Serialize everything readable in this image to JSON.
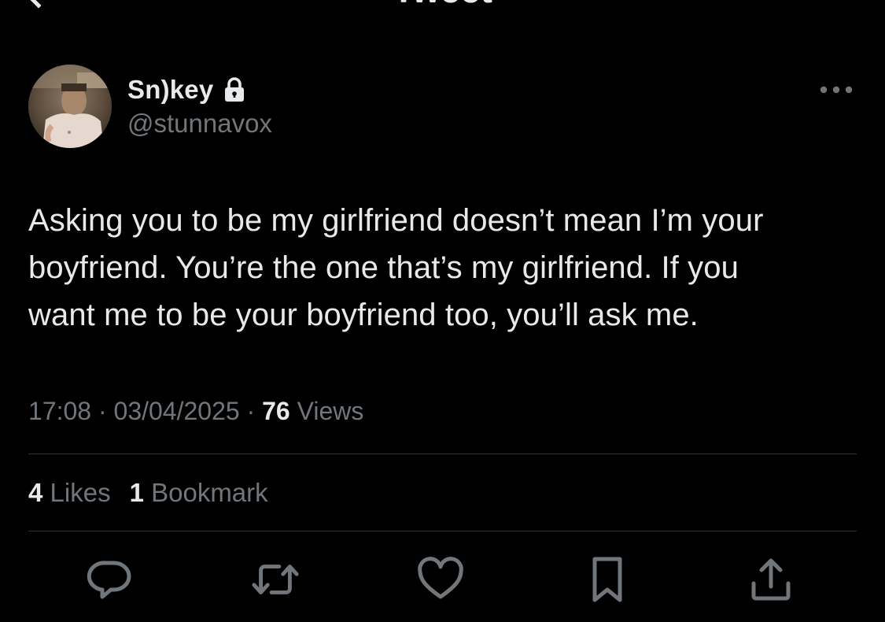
{
  "header": {
    "title": "Tweet"
  },
  "author": {
    "name": "Sn)key",
    "handle": "@stunnavox",
    "protected_icon": "lock-icon",
    "avatar_description_colors": [
      "#4a4036",
      "#d9c3b0"
    ]
  },
  "tweet": {
    "text": "Asking you to be my girlfriend doesn’t mean I’m your\nboyfriend. You’re the one that’s my girlfriend. If you\nwant me to be your boyfriend too, you’ll ask me.",
    "time": "17:08",
    "date": "03/04/2025",
    "separator": " · ",
    "views_count": "76",
    "views_label": " Views"
  },
  "stats": {
    "likes_count": "4",
    "likes_label": " Likes",
    "bookmarks_count": "1",
    "bookmarks_label": " Bookmark"
  },
  "actions": [
    {
      "name": "reply",
      "icon": "reply-icon"
    },
    {
      "name": "retweet",
      "icon": "retweet-icon"
    },
    {
      "name": "like",
      "icon": "heart-icon"
    },
    {
      "name": "bookmark",
      "icon": "bookmark-icon"
    },
    {
      "name": "share",
      "icon": "share-icon"
    }
  ],
  "colors": {
    "background": "#000000",
    "primary_text": "#e7e9ea",
    "secondary_text": "#71767b",
    "divider": "#2f3336",
    "icon": "#71767b"
  }
}
